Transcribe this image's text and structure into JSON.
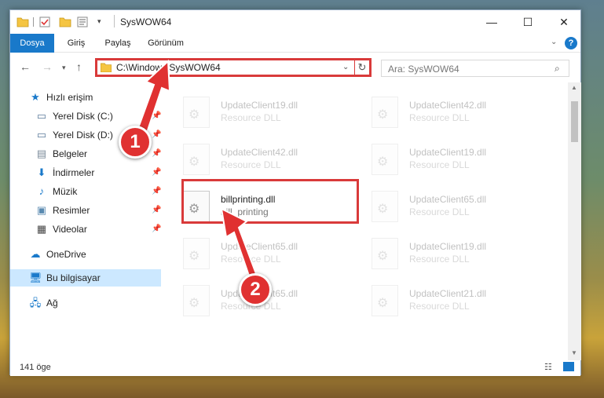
{
  "window": {
    "title": "SysWOW64",
    "controls": {
      "minimize": "—",
      "maximize": "☐",
      "close": "✕"
    }
  },
  "ribbon": {
    "tabs": [
      {
        "label": "Dosya",
        "active": true
      },
      {
        "label": "Giriş"
      },
      {
        "label": "Paylaş"
      },
      {
        "label": "Görünüm"
      }
    ],
    "help_label": "?"
  },
  "nav": {
    "address": "C:\\Windows\\SysWOW64",
    "search_placeholder": "Ara: SysWOW64"
  },
  "sidebar": {
    "items": [
      {
        "label": "Hızlı erişim",
        "icon": "star-icon"
      },
      {
        "label": "Yerel Disk (C:)",
        "icon": "drive-icon",
        "pinned": true
      },
      {
        "label": "Yerel Disk (D:)",
        "icon": "drive-icon",
        "pinned": true
      },
      {
        "label": "Belgeler",
        "icon": "documents-icon",
        "pinned": true
      },
      {
        "label": "İndirmeler",
        "icon": "download-icon",
        "pinned": true
      },
      {
        "label": "Müzik",
        "icon": "music-icon",
        "pinned": true
      },
      {
        "label": "Resimler",
        "icon": "pictures-icon",
        "pinned": true
      },
      {
        "label": "Videolar",
        "icon": "video-icon",
        "pinned": true
      },
      {
        "label": "OneDrive",
        "icon": "cloud-icon"
      },
      {
        "label": "Bu bilgisayar",
        "icon": "computer-icon",
        "selected": true
      },
      {
        "label": "Ağ",
        "icon": "network-icon"
      }
    ]
  },
  "files": [
    {
      "name": "UpdateClient19.dll",
      "type": "Resource DLL",
      "faded": true
    },
    {
      "name": "UpdateClient42.dll",
      "type": "Resource DLL",
      "faded": true
    },
    {
      "name": "UpdateClient42.dll",
      "type": "Resource DLL",
      "faded": true
    },
    {
      "name": "UpdateClient19.dll",
      "type": "Resource DLL",
      "faded": true
    },
    {
      "name": "billprinting.dll",
      "type": "bill_printing",
      "faded": false
    },
    {
      "name": "UpdateClient65.dll",
      "type": "Resource DLL",
      "faded": true
    },
    {
      "name": "UpdateClient65.dll",
      "type": "Resource DLL",
      "faded": true
    },
    {
      "name": "UpdateClient19.dll",
      "type": "Resource DLL",
      "faded": true
    },
    {
      "name": "UpdateClient65.dll",
      "type": "Resource DLL",
      "faded": true
    },
    {
      "name": "UpdateClient21.dll",
      "type": "Resource DLL",
      "faded": true
    }
  ],
  "status": {
    "count": "141 öge"
  },
  "annotations": {
    "badge1": "1",
    "badge2": "2",
    "color": "#e03131"
  }
}
